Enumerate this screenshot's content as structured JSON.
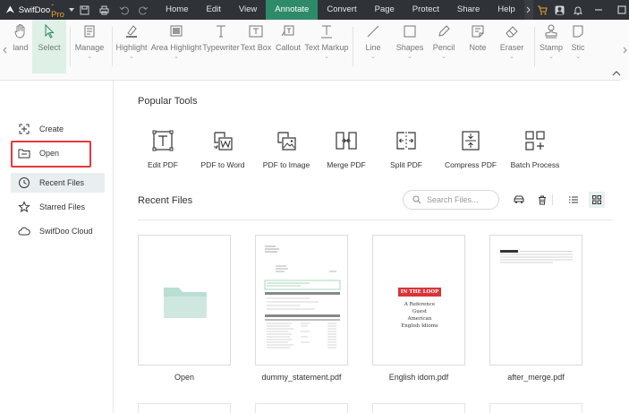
{
  "app": {
    "name": "SwifDoo",
    "edition": "-Pro"
  },
  "menu": {
    "items": [
      {
        "label": "Home",
        "active": false
      },
      {
        "label": "Edit",
        "active": false
      },
      {
        "label": "View",
        "active": false
      },
      {
        "label": "Annotate",
        "active": true
      },
      {
        "label": "Convert",
        "active": false
      },
      {
        "label": "Page",
        "active": false
      },
      {
        "label": "Protect",
        "active": false
      },
      {
        "label": "Share",
        "active": false
      },
      {
        "label": "Help",
        "active": false
      }
    ]
  },
  "ribbon": {
    "tools": [
      {
        "label": "land",
        "icon": "hand-icon"
      },
      {
        "label": "Select",
        "icon": "cursor-icon",
        "selected": true
      },
      {
        "label": "Manage",
        "icon": "stack-icon"
      },
      {
        "label": "Highlight",
        "icon": "highlighter-icon"
      },
      {
        "label": "Area Highlight",
        "icon": "area-highlight-icon"
      },
      {
        "label": "Typewriter",
        "icon": "typewriter-icon"
      },
      {
        "label": "Text Box",
        "icon": "text-box-icon"
      },
      {
        "label": "Callout",
        "icon": "callout-icon"
      },
      {
        "label": "Text Markup",
        "icon": "text-markup-icon"
      },
      {
        "label": "Line",
        "icon": "line-icon"
      },
      {
        "label": "Shapes",
        "icon": "shapes-icon"
      },
      {
        "label": "Pencil",
        "icon": "pencil-icon"
      },
      {
        "label": "Note",
        "icon": "note-icon"
      },
      {
        "label": "Eraser",
        "icon": "eraser-icon"
      },
      {
        "label": "Stamp",
        "icon": "stamp-icon"
      },
      {
        "label": "Stic",
        "icon": "sticker-icon"
      }
    ]
  },
  "sidebar": {
    "items": [
      {
        "label": "Create",
        "icon": "create-icon"
      },
      {
        "label": "Open",
        "icon": "open-folder-icon"
      },
      {
        "label": "Recent Files",
        "icon": "clock-icon",
        "active": true
      },
      {
        "label": "Starred Files",
        "icon": "star-icon"
      },
      {
        "label": "SwifDoo Cloud",
        "icon": "cloud-icon"
      }
    ]
  },
  "popular": {
    "title": "Popular Tools",
    "tools": [
      {
        "label": "Edit PDF",
        "icon": "edit-pdf-icon"
      },
      {
        "label": "PDF to Word",
        "icon": "pdf-to-word-icon"
      },
      {
        "label": "PDF to Image",
        "icon": "pdf-to-image-icon"
      },
      {
        "label": "Merge PDF",
        "icon": "merge-pdf-icon"
      },
      {
        "label": "Split PDF",
        "icon": "split-pdf-icon"
      },
      {
        "label": "Compress PDF",
        "icon": "compress-pdf-icon"
      },
      {
        "label": "Batch Process",
        "icon": "batch-process-icon"
      }
    ]
  },
  "recent": {
    "title": "Recent Files",
    "search_placeholder": "Search Files...",
    "files": [
      {
        "name": "Open"
      },
      {
        "name": "dummy_statement.pdf"
      },
      {
        "name": "English idom.pdf"
      },
      {
        "name": "after_merge.pdf"
      }
    ]
  },
  "thumbnails": {
    "english_idom": {
      "banner": "IN THE LOOP",
      "lines": [
        "A Reference",
        "Guest",
        "American",
        "English Idioms"
      ]
    }
  },
  "colors": {
    "titlebar": "#2f3237",
    "accent": "#2e8b6a",
    "highlight_box": "#e8383d",
    "folder": "#b9ded3"
  }
}
